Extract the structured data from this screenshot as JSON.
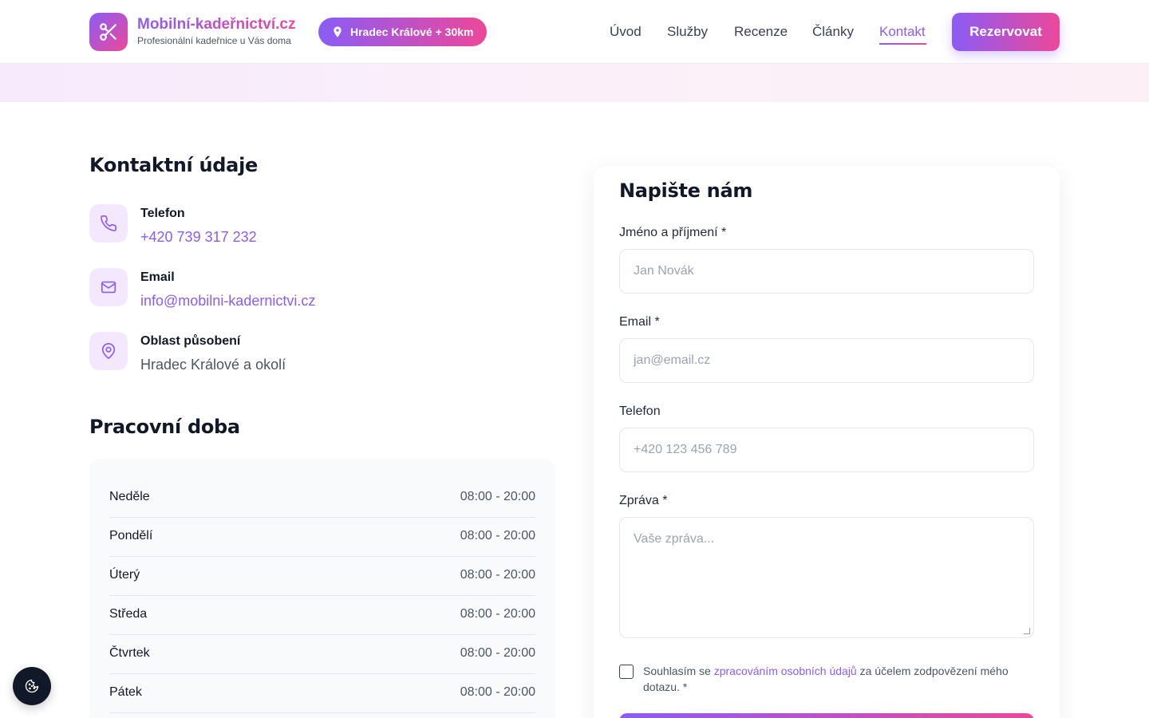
{
  "brand": {
    "title": "Mobilní-kadeřnictví.cz",
    "subtitle": "Profesionální kadeřnice u Vás doma",
    "location_pill": "Hradec Králové + 30km",
    "logo_icon": "scissors-icon"
  },
  "nav": {
    "items": [
      {
        "label": "Úvod",
        "active": false
      },
      {
        "label": "Služby",
        "active": false
      },
      {
        "label": "Recenze",
        "active": false
      },
      {
        "label": "Články",
        "active": false
      },
      {
        "label": "Kontakt",
        "active": true
      }
    ],
    "cta_label": "Rezervovat"
  },
  "contact": {
    "heading": "Kontaktní údaje",
    "items": [
      {
        "label": "Telefon",
        "value": "+420 739 317 232",
        "icon": "phone-icon"
      },
      {
        "label": "Email",
        "value": "info@mobilni-kadernictvi.cz",
        "icon": "mail-icon"
      },
      {
        "label": "Oblast působení",
        "value": "Hradec Králové a okolí",
        "icon": "map-pin-icon"
      }
    ]
  },
  "hours": {
    "heading": "Pracovní doba",
    "rows": [
      {
        "day": "Neděle",
        "time": "08:00 - 20:00"
      },
      {
        "day": "Pondělí",
        "time": "08:00 - 20:00"
      },
      {
        "day": "Úterý",
        "time": "08:00 - 20:00"
      },
      {
        "day": "Středa",
        "time": "08:00 - 20:00"
      },
      {
        "day": "Čtvrtek",
        "time": "08:00 - 20:00"
      },
      {
        "day": "Pátek",
        "time": "08:00 - 20:00"
      }
    ]
  },
  "form": {
    "heading": "Napište nám",
    "name": {
      "label": "Jméno a příjmení *",
      "placeholder": "Jan Novák"
    },
    "email": {
      "label": "Email *",
      "placeholder": "jan@email.cz"
    },
    "phone": {
      "label": "Telefon",
      "placeholder": "+420 123 456 789"
    },
    "message": {
      "label": "Zpráva *",
      "placeholder": "Vaše zpráva..."
    },
    "consent": {
      "before": "Souhlasím se ",
      "link": "zpracováním osobních údajů",
      "after": " za účelem zodpovězení mého dotazu. *"
    }
  },
  "colors": {
    "accent_start": "#8b5cf6",
    "accent_end": "#ec4899"
  }
}
